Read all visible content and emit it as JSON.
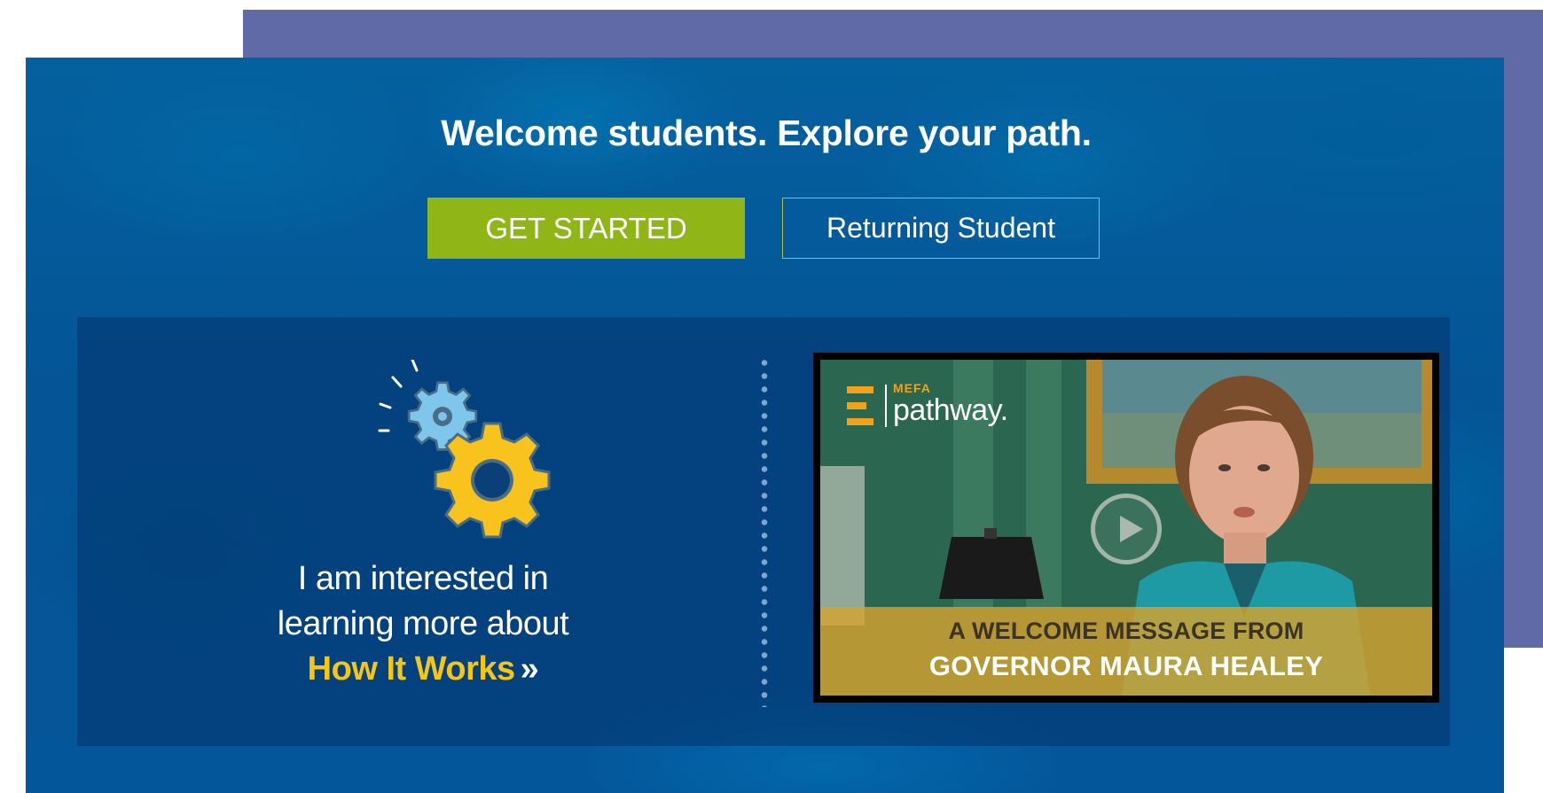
{
  "hero": {
    "headline": "Welcome students. Explore your path.",
    "get_started_label": "GET STARTED",
    "returning_label": "Returning Student"
  },
  "interest": {
    "line1": "I am interested in",
    "line2": "learning more about",
    "link_label": "How It Works",
    "link_arrow": "»",
    "icon": "gears-icon"
  },
  "video": {
    "brand_small": "MEFA",
    "brand_name": "pathway.",
    "caption_line1": "A WELCOME MESSAGE FROM",
    "caption_line2": "GOVERNOR MAURA HEALEY",
    "play_icon": "play-icon"
  },
  "colors": {
    "background_back": "#5f6aa6",
    "hero_blue": "#04569a",
    "accent_green": "#8fb517",
    "accent_yellow": "#f5c518",
    "brand_orange": "#f2a21a",
    "banner_gold": "#d6a230"
  }
}
